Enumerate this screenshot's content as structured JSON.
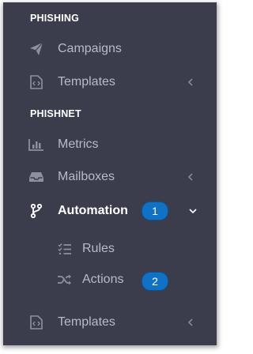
{
  "sections": {
    "phishing": "PHISHING",
    "phishnet": "PHISHNET"
  },
  "items": {
    "campaigns": "Campaigns",
    "templates": "Templates",
    "metrics": "Metrics",
    "mailboxes": "Mailboxes",
    "automation": "Automation",
    "rules": "Rules",
    "actions": "Actions",
    "templates2": "Templates"
  },
  "callouts": {
    "one": "1",
    "two": "2"
  },
  "icons": {
    "campaigns": "paper-plane-icon",
    "templates": "file-code-icon",
    "metrics": "bar-chart-icon",
    "mailboxes": "inbox-tray-icon",
    "automation": "branch-icon",
    "rules": "checklist-icon",
    "actions": "shuffle-icon"
  },
  "colors": {
    "sidebar_bg": "#3b3d4d",
    "badge_bg": "#1171c5"
  }
}
